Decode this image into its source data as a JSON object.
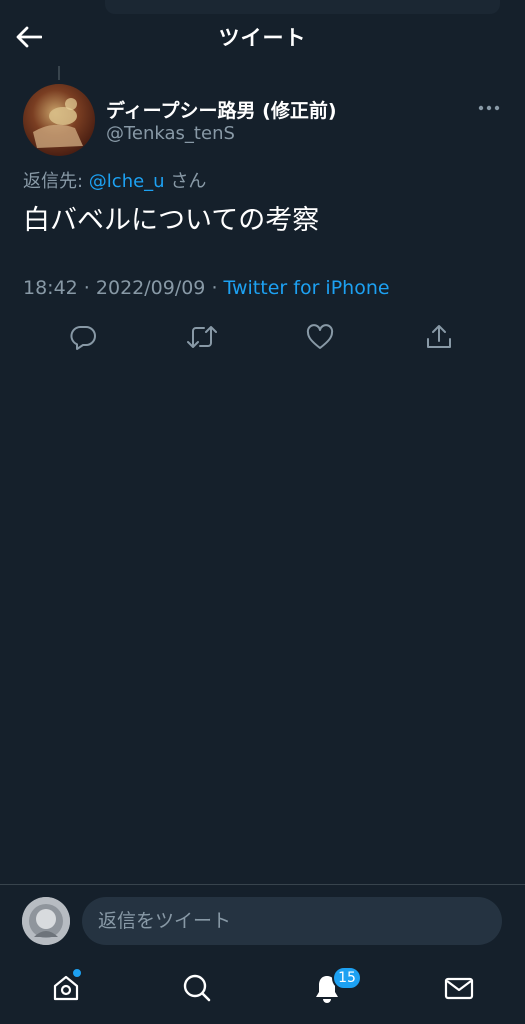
{
  "header": {
    "title": "ツイート",
    "back_icon": "arrow-left-icon"
  },
  "tweet": {
    "display_name": "ディープシー路男 (修正前)",
    "handle": "@Tenkas_tenS",
    "reply_prefix": "返信先: ",
    "reply_mention": "@lche_u",
    "reply_suffix": " さん",
    "text": "白バベルについての考察",
    "time": "18:42",
    "separator": " · ",
    "date": "2022/09/09",
    "source": "Twitter for iPhone",
    "actions": [
      "reply-icon",
      "retweet-icon",
      "like-icon",
      "share-icon"
    ]
  },
  "composer": {
    "placeholder": "返信をツイート"
  },
  "tabbar": {
    "tabs": [
      "home-icon",
      "search-icon",
      "notifications-icon",
      "messages-icon"
    ],
    "notifications_count": "15"
  },
  "colors": {
    "background": "#15202b",
    "accent": "#1da1f2",
    "secondary_text": "#8899a6",
    "divider": "#38444d"
  }
}
